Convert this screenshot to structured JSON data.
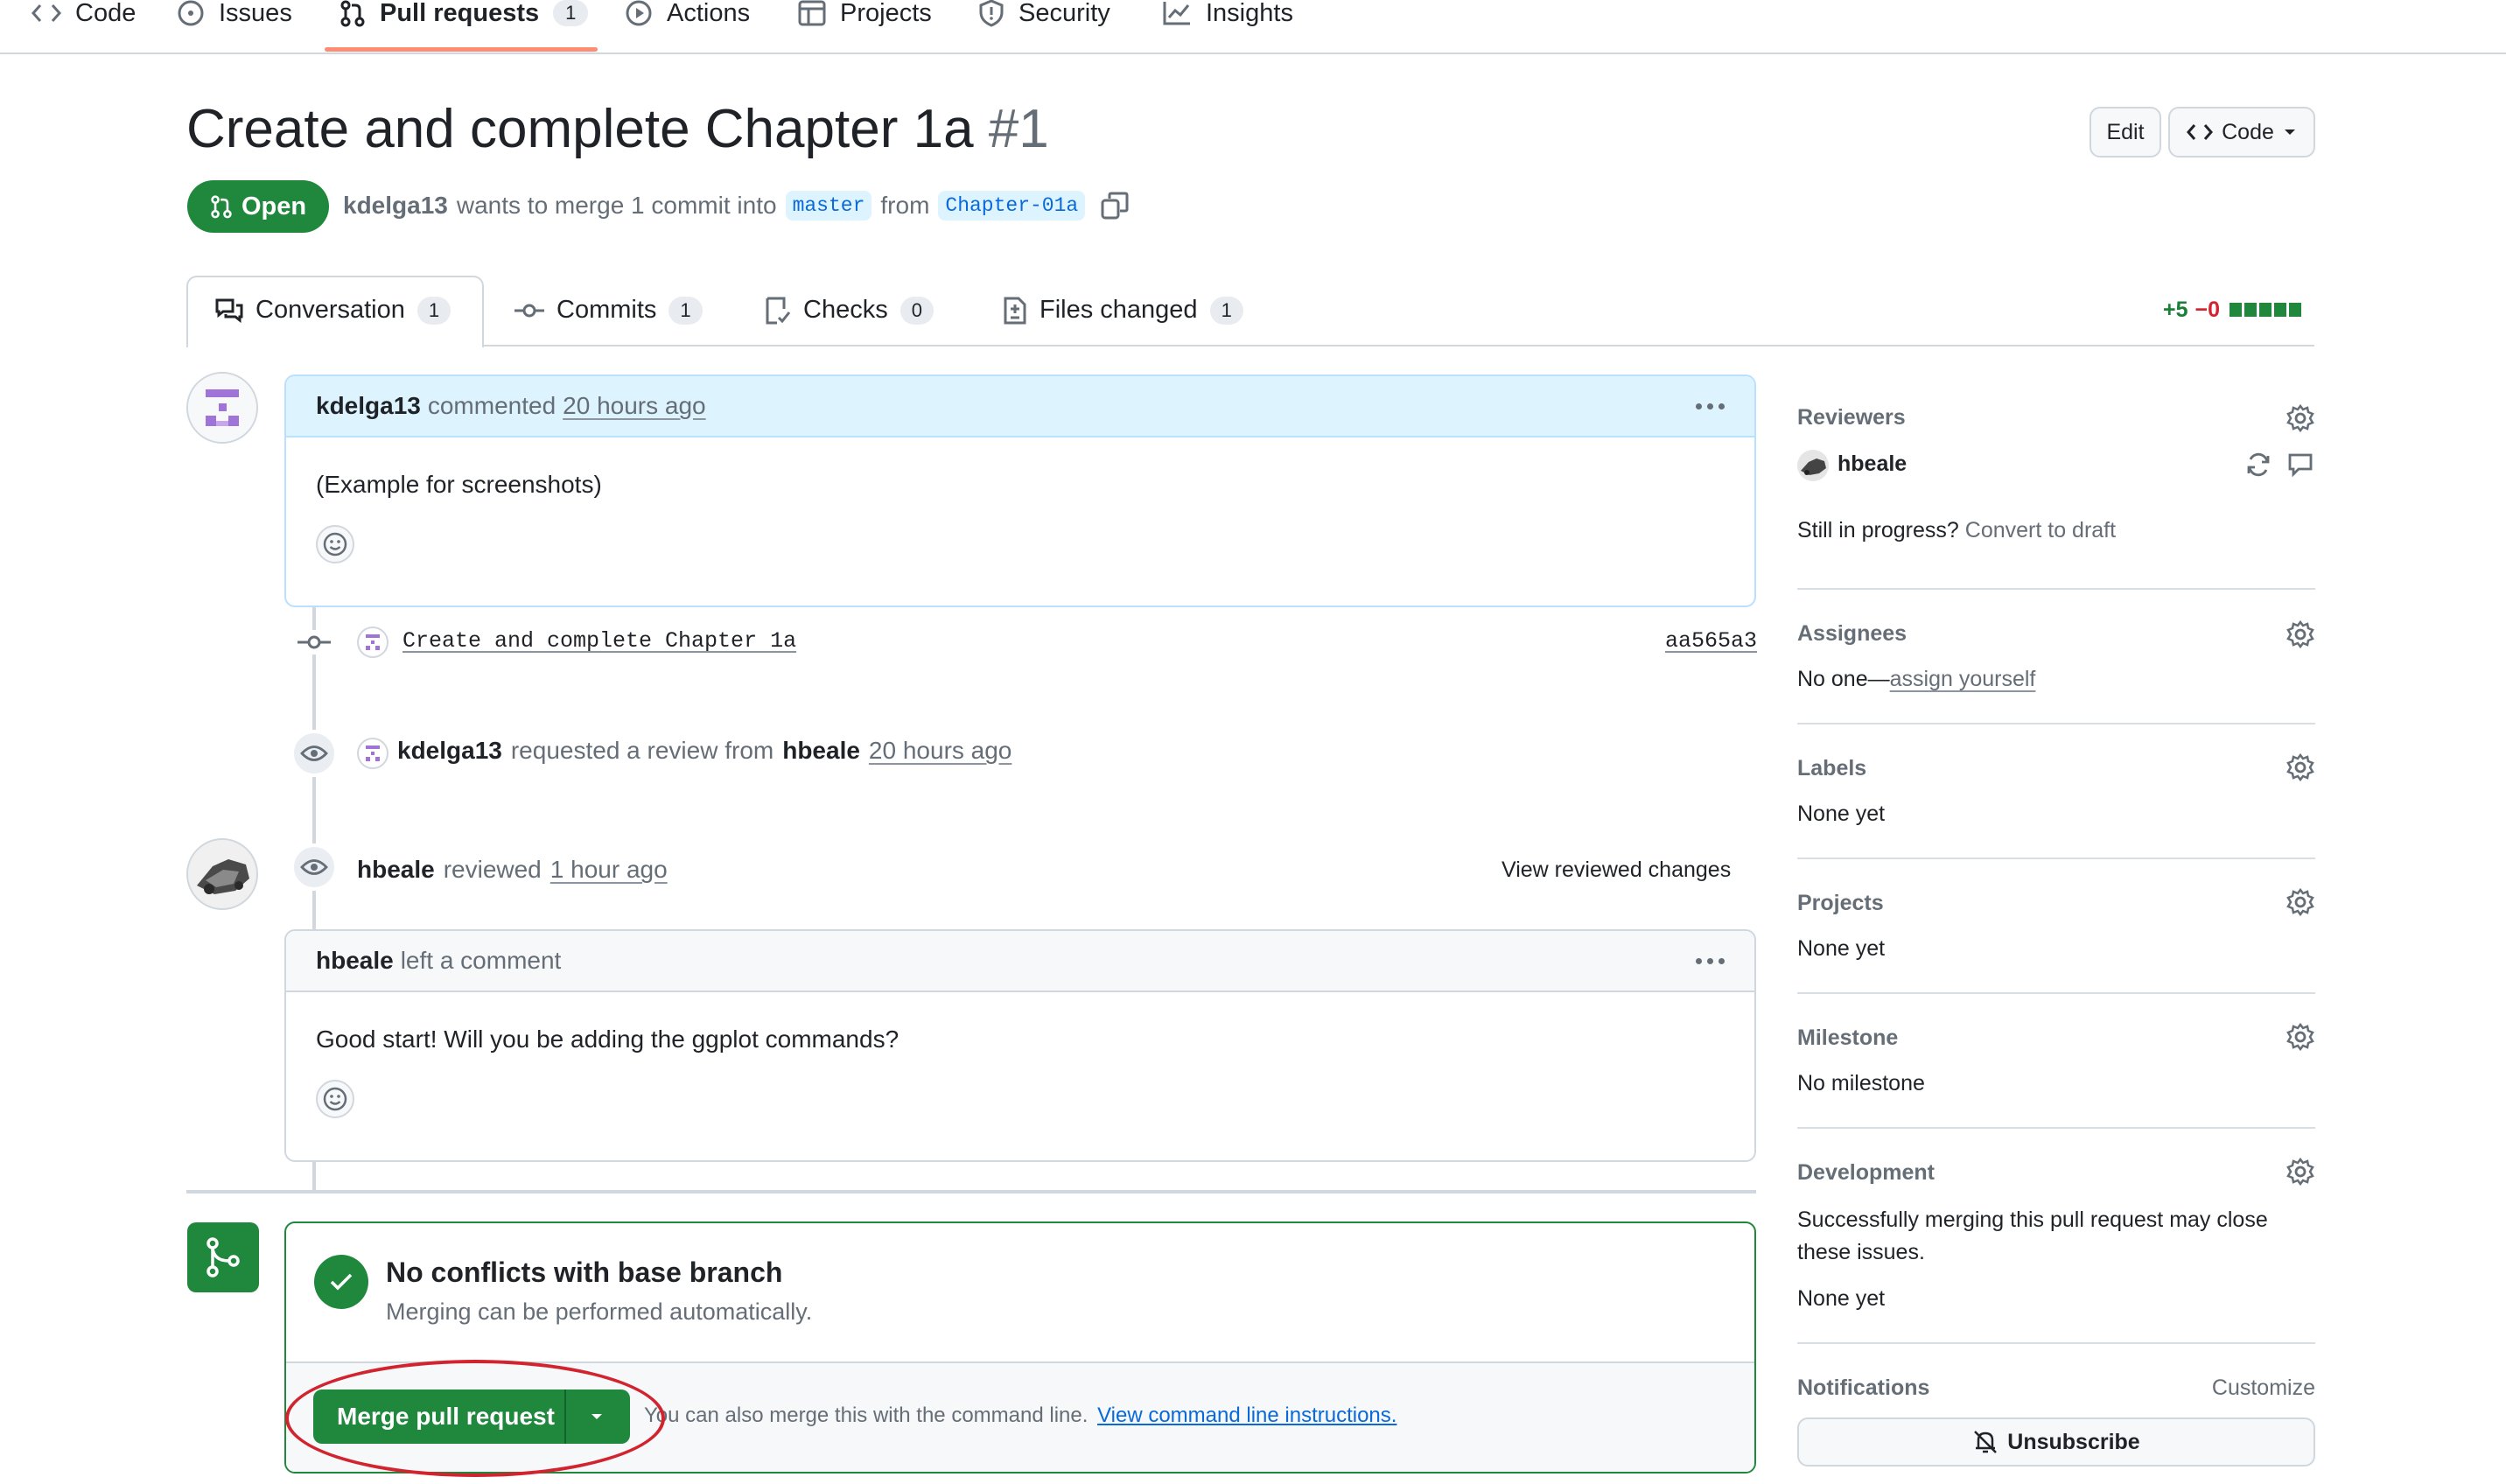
{
  "nav": {
    "items": [
      {
        "label": "Code",
        "icon": "code-icon"
      },
      {
        "label": "Issues",
        "icon": "issue-icon"
      },
      {
        "label": "Pull requests",
        "icon": "pull-request-icon",
        "count": "1",
        "active": true
      },
      {
        "label": "Actions",
        "icon": "play-icon"
      },
      {
        "label": "Projects",
        "icon": "table-icon"
      },
      {
        "label": "Security",
        "icon": "shield-icon"
      },
      {
        "label": "Insights",
        "icon": "graph-icon"
      }
    ]
  },
  "header": {
    "title": "Create and complete Chapter 1a",
    "number": "#1",
    "edit_label": "Edit",
    "code_label": "Code",
    "state": "Open",
    "author": "kdelga13",
    "merge_text": "wants to merge 1 commit into",
    "base_branch": "master",
    "from_text": "from",
    "head_branch": "Chapter-01a"
  },
  "tabs": [
    {
      "label": "Conversation",
      "count": "1"
    },
    {
      "label": "Commits",
      "count": "1"
    },
    {
      "label": "Checks",
      "count": "0"
    },
    {
      "label": "Files changed",
      "count": "1"
    }
  ],
  "diffstat": {
    "additions": "+5",
    "deletions": "−0"
  },
  "timeline": {
    "comment1": {
      "author": "kdelga13",
      "action": "commented",
      "time": "20 hours ago",
      "body": "(Example for screenshots)"
    },
    "commit": {
      "message": "Create and complete Chapter 1a",
      "sha": "aa565a3"
    },
    "review_request": {
      "author": "kdelga13",
      "text": "requested a review from",
      "reviewer": "hbeale",
      "time": "20 hours ago"
    },
    "review": {
      "author": "hbeale",
      "action": "reviewed",
      "time": "1 hour ago",
      "view_changes": "View reviewed changes"
    },
    "comment2": {
      "author": "hbeale",
      "action": "left a comment",
      "body": "Good start! Will you be adding the ggplot commands?"
    }
  },
  "merge": {
    "title": "No conflicts with base branch",
    "subtitle": "Merging can be performed automatically.",
    "button_label": "Merge pull request",
    "hint": "You can also merge this with the command line.",
    "hint_link": "View command line instructions."
  },
  "sidebar": {
    "reviewers": {
      "heading": "Reviewers",
      "name": "hbeale",
      "draft_text": "Still in progress?",
      "draft_link": "Convert to draft"
    },
    "assignees": {
      "heading": "Assignees",
      "text": "No one—",
      "link": "assign yourself"
    },
    "labels": {
      "heading": "Labels",
      "value": "None yet"
    },
    "projects": {
      "heading": "Projects",
      "value": "None yet"
    },
    "milestone": {
      "heading": "Milestone",
      "value": "No milestone"
    },
    "development": {
      "heading": "Development",
      "text": "Successfully merging this pull request may close these issues.",
      "value": "None yet"
    },
    "notifications": {
      "heading": "Notifications",
      "customize": "Customize",
      "unsubscribe": "Unsubscribe"
    }
  },
  "colors": {
    "accent_green": "#1f883d",
    "link_blue": "#0969da",
    "highlight_red": "#d1242f",
    "tab_underline": "#fd8c73"
  }
}
